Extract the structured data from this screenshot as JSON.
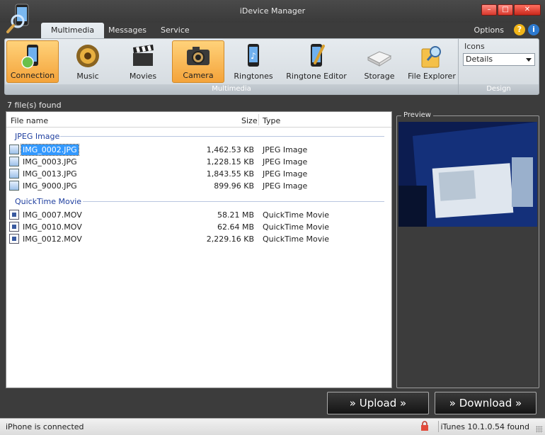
{
  "window": {
    "title": "iDevice Manager"
  },
  "tabs": [
    {
      "label": "Multimedia",
      "active": true
    },
    {
      "label": "Messages",
      "active": false
    },
    {
      "label": "Service",
      "active": false
    }
  ],
  "options_label": "Options",
  "ribbon": {
    "buttons": [
      {
        "label": "Connection",
        "icon": "phone-connection-icon",
        "active": true
      },
      {
        "label": "Music",
        "icon": "speaker-icon",
        "active": false
      },
      {
        "label": "Movies",
        "icon": "clapperboard-icon",
        "active": false
      },
      {
        "label": "Camera",
        "icon": "camera-icon",
        "active": true
      },
      {
        "label": "Ringtones",
        "icon": "ringtone-phone-icon",
        "active": false
      },
      {
        "label": "Ringtone Editor",
        "icon": "ringtone-editor-icon",
        "active": false
      },
      {
        "label": "Storage",
        "icon": "drive-icon",
        "active": false
      },
      {
        "label": "File Explorer",
        "icon": "folder-search-icon",
        "active": false
      }
    ],
    "group_label": "Multimedia",
    "design": {
      "icons_label": "Icons",
      "view_value": "Details",
      "group_label": "Design"
    }
  },
  "files_found": "7 file(s) found",
  "list": {
    "columns": {
      "name": "File name",
      "size": "Size",
      "type": "Type"
    },
    "groups": [
      {
        "label": "JPEG Image",
        "files": [
          {
            "name": "IMG_0002.JPG",
            "size": "1,462.53 KB",
            "type": "JPEG Image",
            "selected": true
          },
          {
            "name": "IMG_0003.JPG",
            "size": "1,228.15 KB",
            "type": "JPEG Image"
          },
          {
            "name": "IMG_0013.JPG",
            "size": "1,843.55 KB",
            "type": "JPEG Image"
          },
          {
            "name": "IMG_9000.JPG",
            "size": "899.96 KB",
            "type": "JPEG Image"
          }
        ]
      },
      {
        "label": "QuickTime Movie",
        "files": [
          {
            "name": "IMG_0007.MOV",
            "size": "58.21 MB",
            "type": "QuickTime Movie"
          },
          {
            "name": "IMG_0010.MOV",
            "size": "62.64 MB",
            "type": "QuickTime Movie"
          },
          {
            "name": "IMG_0012.MOV",
            "size": "2,229.16 KB",
            "type": "QuickTime Movie"
          }
        ]
      }
    ]
  },
  "preview_label": "Preview",
  "upload_label": "» Upload »",
  "download_label": "» Download »",
  "status": {
    "left": "iPhone is connected",
    "right": "iTunes 10.1.0.54 found"
  }
}
